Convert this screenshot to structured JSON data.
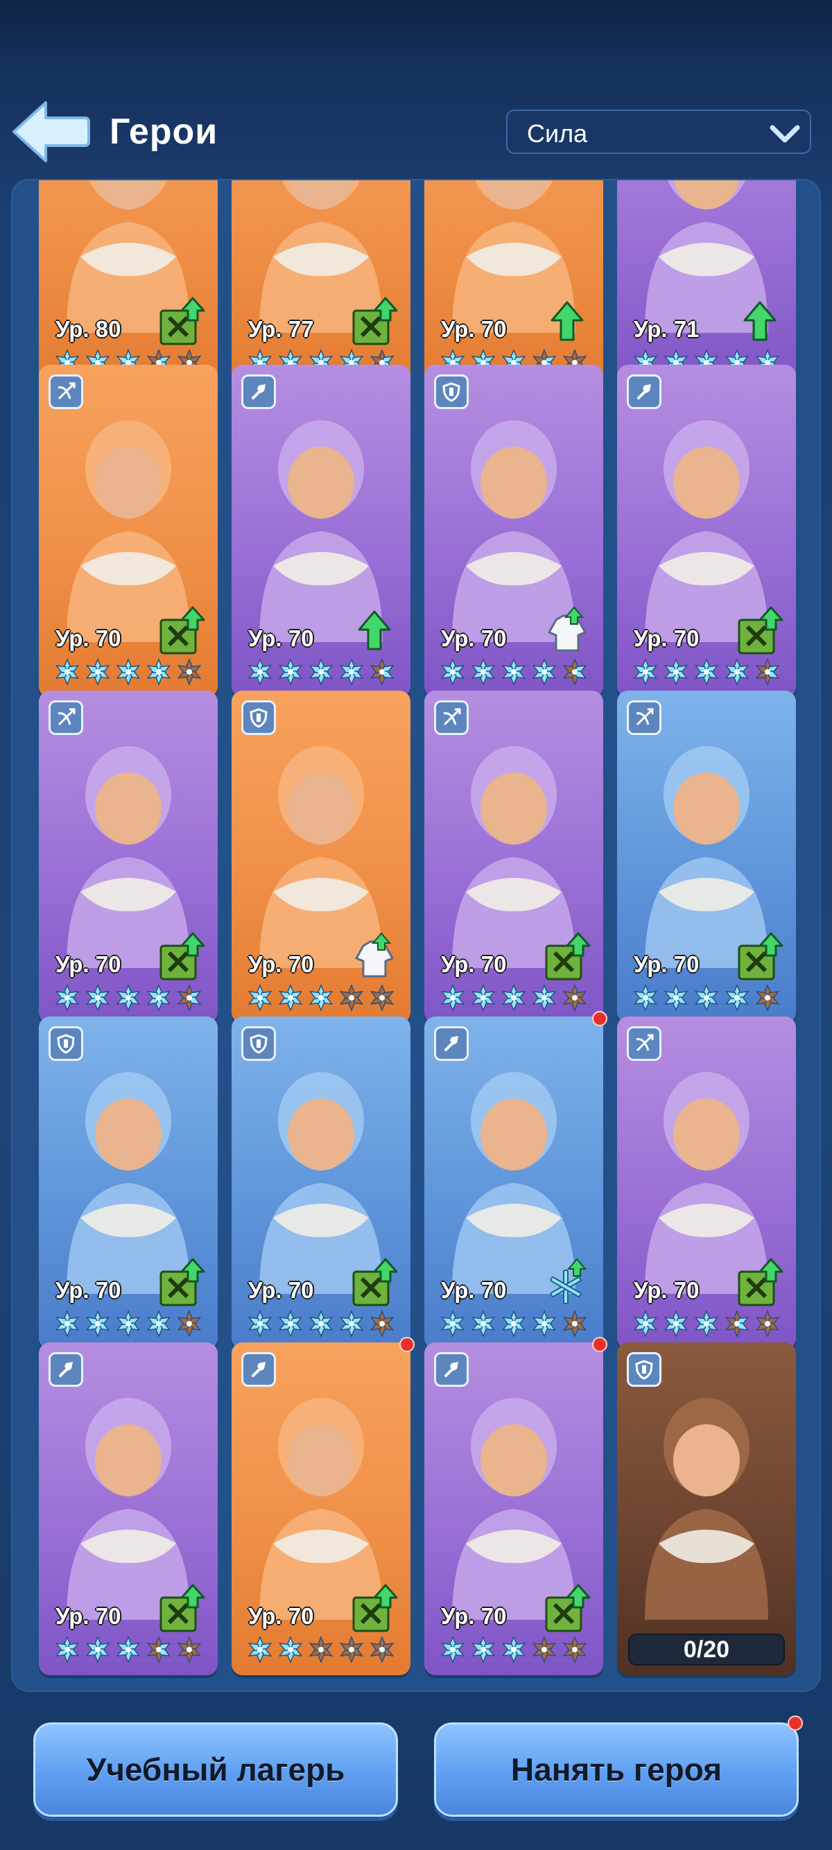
{
  "header": {
    "title": "Герои",
    "sort_value": "Сила"
  },
  "level_prefix": "Ур.",
  "colors": {
    "orange": "#f09048",
    "purple": "#9a6fd6",
    "blue": "#5f95da",
    "star_filled": "#8fe6ff",
    "star_empty": "#a86a3e"
  },
  "heroes": [
    {
      "level": "80",
      "rarity": "orange",
      "class_icon": "",
      "stars": [
        1,
        1,
        1,
        0.5,
        0
      ],
      "upgrade": "manual",
      "dot": false,
      "partial": true
    },
    {
      "level": "77",
      "rarity": "orange",
      "class_icon": "",
      "stars": [
        1,
        1,
        1,
        1,
        0.5
      ],
      "upgrade": "manual",
      "dot": false,
      "partial": true
    },
    {
      "level": "70",
      "rarity": "orange",
      "class_icon": "",
      "stars": [
        1,
        1,
        1,
        0.5,
        0
      ],
      "upgrade": "arrow",
      "dot": false,
      "partial": true
    },
    {
      "level": "71",
      "rarity": "purple",
      "class_icon": "",
      "stars": [
        1,
        1,
        1,
        1,
        1
      ],
      "upgrade": "arrow",
      "dot": false,
      "partial": true
    },
    {
      "level": "70",
      "rarity": "orange",
      "class_icon": "crossbow",
      "stars": [
        1,
        1,
        1,
        1,
        0
      ],
      "upgrade": "manual",
      "dot": false
    },
    {
      "level": "70",
      "rarity": "purple",
      "class_icon": "spear",
      "stars": [
        1,
        1,
        1,
        1,
        0.5
      ],
      "upgrade": "arrow",
      "dot": false
    },
    {
      "level": "70",
      "rarity": "purple",
      "class_icon": "shield",
      "stars": [
        1,
        1,
        1,
        1,
        0.5
      ],
      "upgrade": "coat",
      "dot": false
    },
    {
      "level": "70",
      "rarity": "purple",
      "class_icon": "spear",
      "stars": [
        1,
        1,
        1,
        1,
        0.5
      ],
      "upgrade": "manual",
      "dot": false
    },
    {
      "level": "70",
      "rarity": "purple",
      "class_icon": "crossbow",
      "stars": [
        1,
        1,
        1,
        1,
        0.5
      ],
      "upgrade": "manual",
      "dot": false
    },
    {
      "level": "70",
      "rarity": "orange",
      "class_icon": "shield",
      "stars": [
        1,
        1,
        1,
        0,
        0
      ],
      "upgrade": "coat",
      "dot": false
    },
    {
      "level": "70",
      "rarity": "purple",
      "class_icon": "crossbow",
      "stars": [
        1,
        1,
        1,
        1,
        0
      ],
      "upgrade": "manual",
      "dot": false
    },
    {
      "level": "70",
      "rarity": "blue",
      "class_icon": "crossbow",
      "stars": [
        1,
        1,
        1,
        1,
        0
      ],
      "upgrade": "manual",
      "dot": false
    },
    {
      "level": "70",
      "rarity": "blue",
      "class_icon": "shield",
      "stars": [
        1,
        1,
        1,
        1,
        0
      ],
      "upgrade": "manual",
      "dot": false
    },
    {
      "level": "70",
      "rarity": "blue",
      "class_icon": "shield",
      "stars": [
        1,
        1,
        1,
        1,
        0
      ],
      "upgrade": "manual",
      "dot": false
    },
    {
      "level": "70",
      "rarity": "blue",
      "class_icon": "spear",
      "stars": [
        1,
        1,
        1,
        1,
        0
      ],
      "upgrade": "snowflake",
      "dot": true
    },
    {
      "level": "70",
      "rarity": "purple",
      "class_icon": "crossbow",
      "stars": [
        1,
        1,
        1,
        0.5,
        0
      ],
      "upgrade": "manual",
      "dot": false
    },
    {
      "level": "70",
      "rarity": "purple",
      "class_icon": "spear",
      "stars": [
        1,
        1,
        1,
        0.5,
        0
      ],
      "upgrade": "manual",
      "dot": false
    },
    {
      "level": "70",
      "rarity": "orange",
      "class_icon": "spear",
      "stars": [
        1,
        1,
        0,
        0,
        0
      ],
      "upgrade": "manual",
      "dot": true
    },
    {
      "level": "70",
      "rarity": "purple",
      "class_icon": "spear",
      "stars": [
        1,
        1,
        1,
        0,
        0
      ],
      "upgrade": "manual",
      "dot": true
    },
    {
      "level": "",
      "rarity": "brown",
      "class_icon": "shield",
      "stars": [],
      "upgrade": "none",
      "dot": false,
      "fragments": "0/20"
    }
  ],
  "buttons": {
    "training_camp": "Учебный лагерь",
    "hire_hero": "Нанять героя"
  }
}
